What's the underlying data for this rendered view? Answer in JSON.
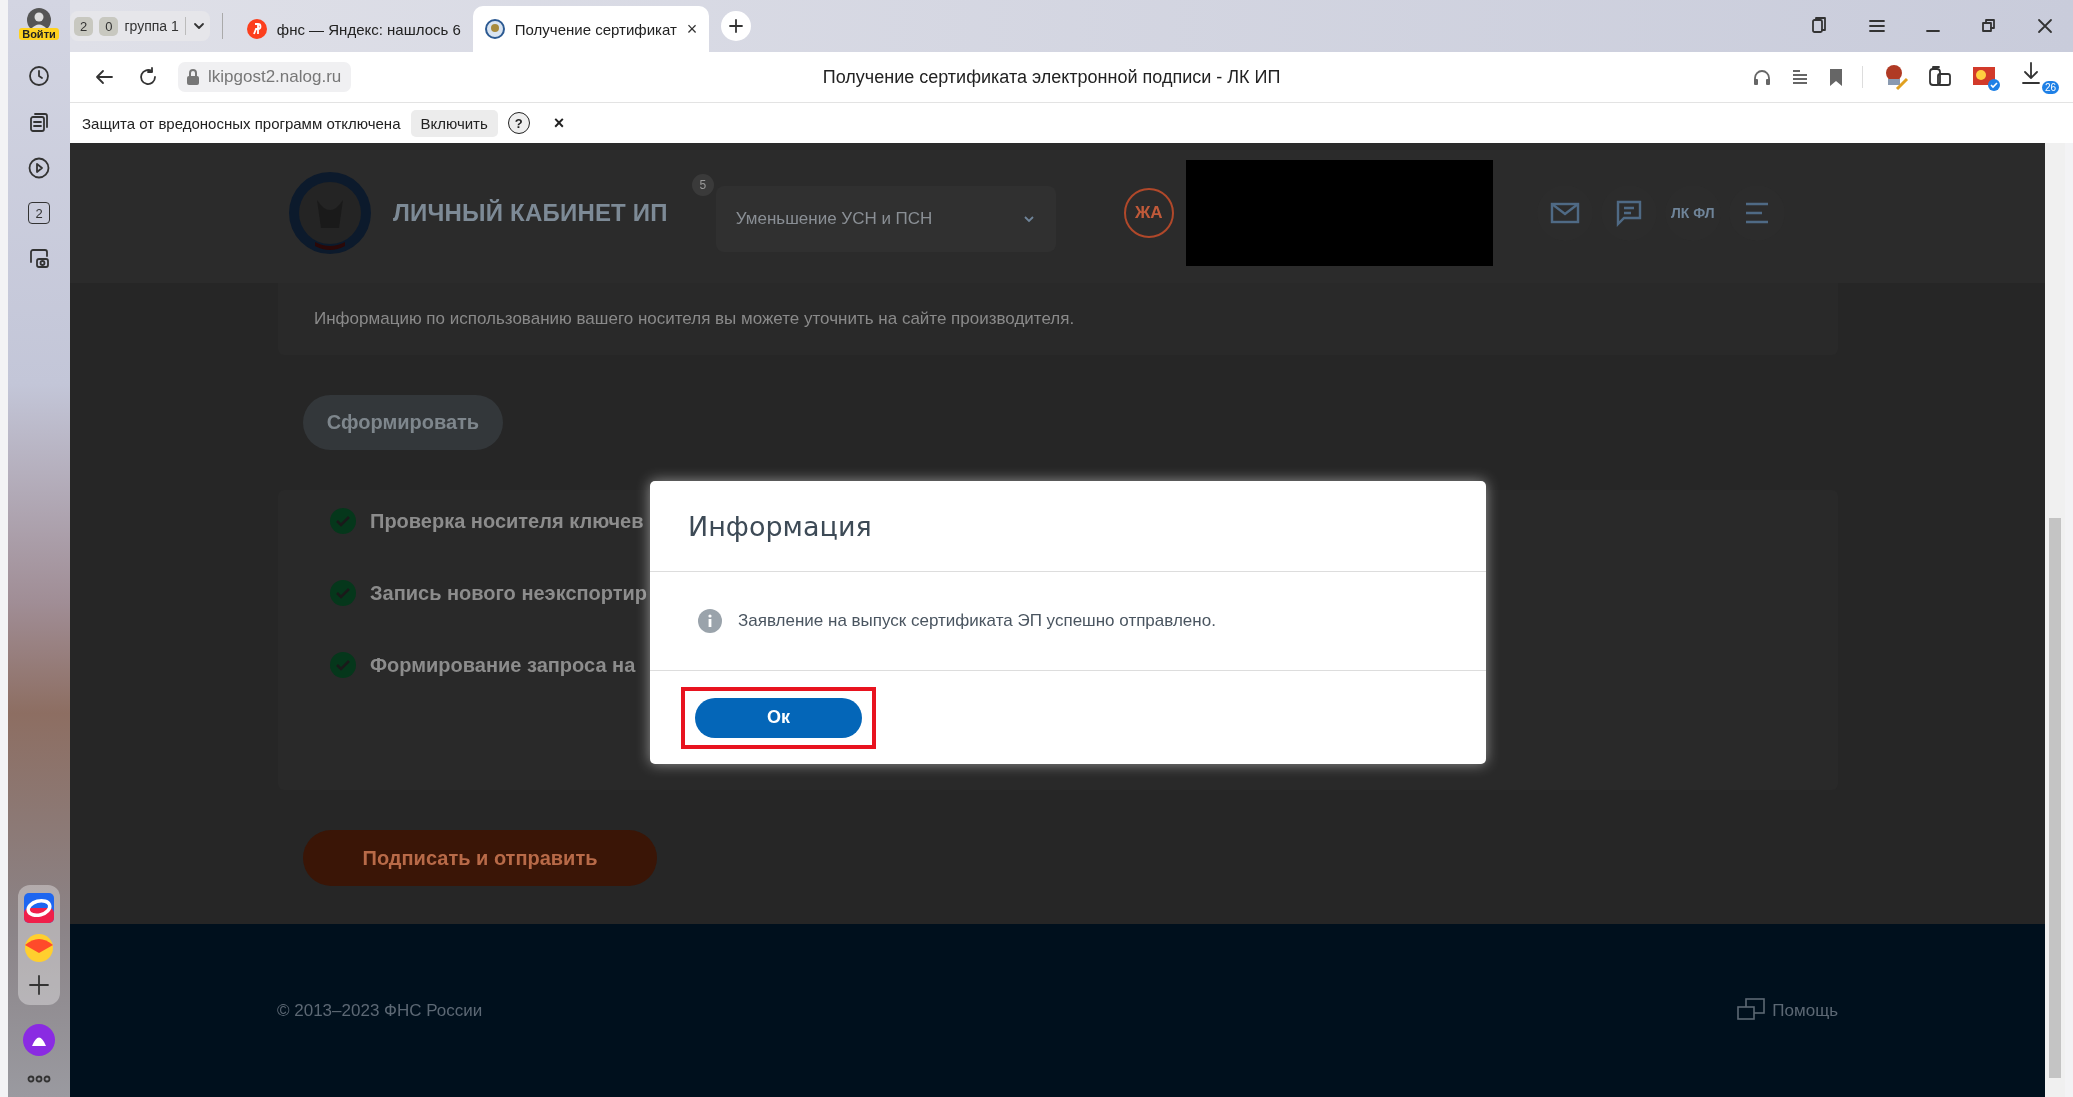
{
  "browser": {
    "account_label": "Войти",
    "sidebar_tabs_count": "2",
    "tab_groups": [
      {
        "count": "2"
      },
      {
        "count": "0",
        "label": "группа 1"
      }
    ],
    "tabs": [
      {
        "title": "фнс — Яндекс: нашлось 6",
        "kind": "search",
        "selected": false
      },
      {
        "title": "Получение сертификат",
        "kind": "site",
        "selected": true
      }
    ],
    "url": "lkipgost2.nalog.ru",
    "page_title": "Получение сертификата электронной подписи - ЛК ИП",
    "downloads_count": "26"
  },
  "notice_bar": {
    "text": "Защита от вредоносных программ отключена",
    "button": "Включить",
    "help": "?",
    "close": "×"
  },
  "page": {
    "header": {
      "title": "ЛИЧНЫЙ КАБИНЕТ ИП",
      "service_select": {
        "value": "Уменьшение УСН и ПСН",
        "badge": "5"
      },
      "avatar_initials": "ЖА",
      "lk_fl": "ЛК ФЛ"
    },
    "info_text": "Информацию по использованию вашего носителя вы можете уточнить на сайте производителя.",
    "form_button": "Сформировать",
    "steps": [
      {
        "text": "Проверка носителя ключев",
        "done": true
      },
      {
        "text": "Запись нового неэкспортир",
        "done": true
      },
      {
        "text": "Формирование запроса на",
        "done": true
      }
    ],
    "submit_button": "Подписать и отправить",
    "footer": {
      "copyright": "© 2013–2023 ФНС России",
      "help": "Помощь"
    }
  },
  "dialog": {
    "title": "Информация",
    "message": "Заявление на выпуск сертификата ЭП успешно отправлено.",
    "ok_button": "Ок",
    "ok_highlighted": true
  }
}
